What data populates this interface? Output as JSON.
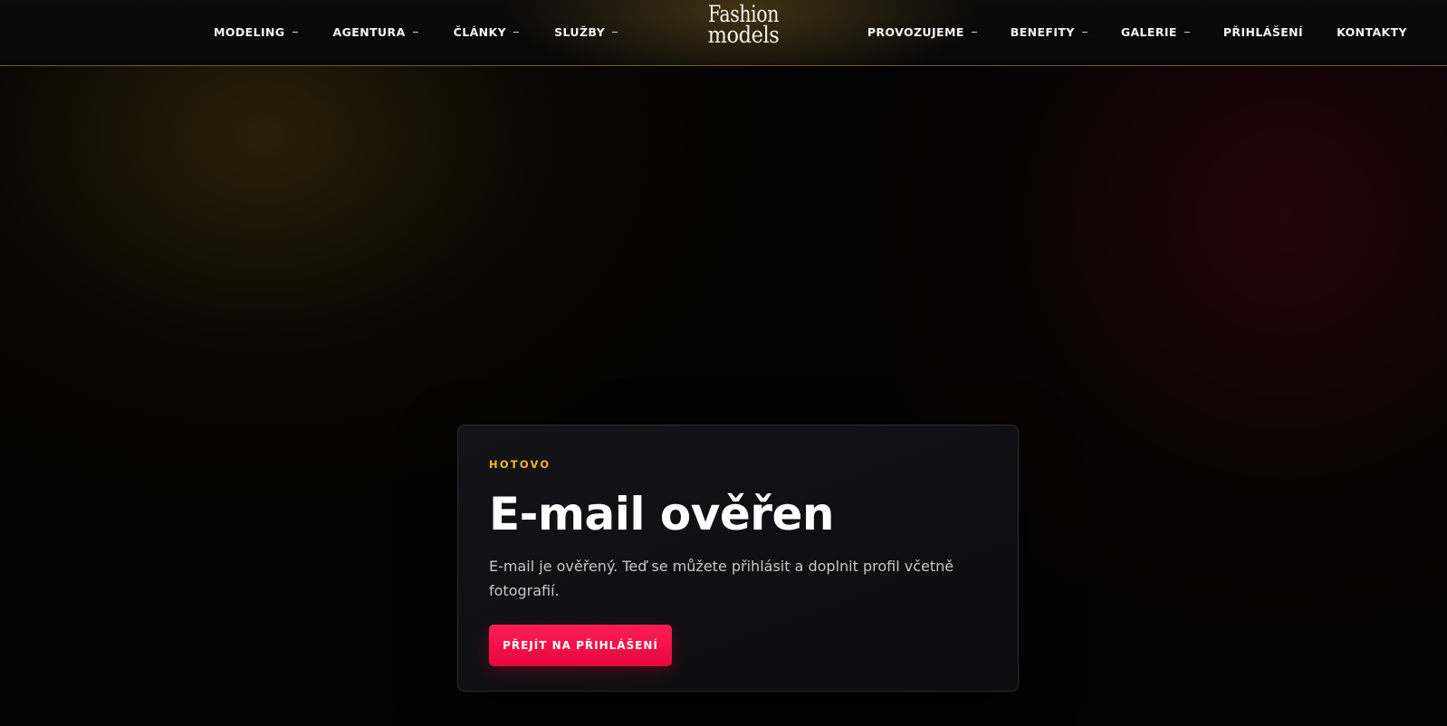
{
  "header": {
    "nav_left": [
      {
        "label": "MODELING",
        "dropdown": true
      },
      {
        "label": "AGENTURA",
        "dropdown": true
      },
      {
        "label": "ČLÁNKY",
        "dropdown": true
      },
      {
        "label": "SLUŽBY",
        "dropdown": true
      }
    ],
    "logo": {
      "line1": "Fashion",
      "line2": "models"
    },
    "nav_right": [
      {
        "label": "PROVOZUJEME",
        "dropdown": true
      },
      {
        "label": "BENEFITY",
        "dropdown": true
      },
      {
        "label": "GALERIE",
        "dropdown": true
      },
      {
        "label": "PŘIHLÁŠENÍ",
        "dropdown": false
      },
      {
        "label": "KONTAKTY",
        "dropdown": false
      }
    ]
  },
  "card": {
    "eyebrow": "HOTOVO",
    "title": "E-mail ověřen",
    "description": "E-mail je ověřený. Teď se můžete přihlásit a doplnit profil včetně fotografií.",
    "button_label": "PŘEJÍT NA PŘIHLÁŠENÍ"
  },
  "colors": {
    "accent_gold": "#f2b71d",
    "cta_red": "#ff1d55",
    "header_border": "#6e5a37",
    "background": "#030303"
  },
  "icons": {
    "dropdown": "chevron-down-icon"
  }
}
